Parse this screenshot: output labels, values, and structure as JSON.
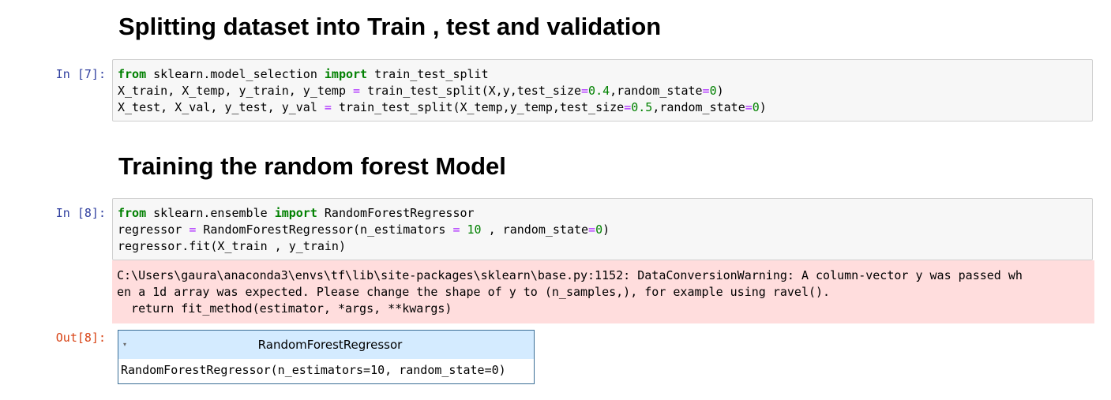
{
  "headings": {
    "split": "Splitting dataset into Train , test and validation",
    "train": "Training the random forest Model"
  },
  "cells": {
    "cell7": {
      "prompt": "In [7]:",
      "code": {
        "l1": {
          "a": "from",
          "b": " sklearn.model_selection ",
          "c": "import",
          "d": " train_test_split"
        },
        "l2": {
          "a": "X_train, X_temp, y_train, y_temp ",
          "b": "=",
          "c": " train_test_split(X,y,test_size",
          "d": "=",
          "e": "0.4",
          "f": ",random_state",
          "g": "=",
          "h": "0",
          "i": ")"
        },
        "l3": {
          "a": "X_test, X_val, y_test, y_val ",
          "b": "=",
          "c": " train_test_split(X_temp,y_temp,test_size",
          "d": "=",
          "e": "0.5",
          "f": ",random_state",
          "g": "=",
          "h": "0",
          "i": ")"
        }
      }
    },
    "cell8": {
      "prompt": "In [8]:",
      "code": {
        "l1": {
          "a": "from",
          "b": " sklearn.ensemble ",
          "c": "import",
          "d": " RandomForestRegressor"
        },
        "l2": {
          "a": "regressor ",
          "b": "=",
          "c": " RandomForestRegressor(n_estimators ",
          "d": "=",
          "e": " ",
          "f": "10",
          "g": " , random_state",
          "h": "=",
          "i": "0",
          "j": ")"
        },
        "l3": {
          "a": "regressor.fit(X_train , y_train)"
        }
      },
      "stderr": {
        "l1": "C:\\Users\\gaura\\anaconda3\\envs\\tf\\lib\\site-packages\\sklearn\\base.py:1152: DataConversionWarning: A column-vector y was passed wh",
        "l2": "en a 1d array was expected. Please change the shape of y to (n_samples,), for example using ravel().",
        "l3": "  return fit_method(estimator, *args, **kwargs)"
      },
      "out_prompt": "Out[8]:",
      "widget": {
        "toggle": "▾",
        "title": "RandomForestRegressor",
        "repr": "RandomForestRegressor(n_estimators=10, random_state=0)"
      }
    }
  },
  "colors": {
    "keyword": "#008000",
    "operator": "#aa22ff",
    "number": "#008000",
    "in_prompt": "#303f9f",
    "out_prompt": "#d84315",
    "stderr_bg": "#ffdddd",
    "widget_header_bg": "#d4ebff"
  }
}
